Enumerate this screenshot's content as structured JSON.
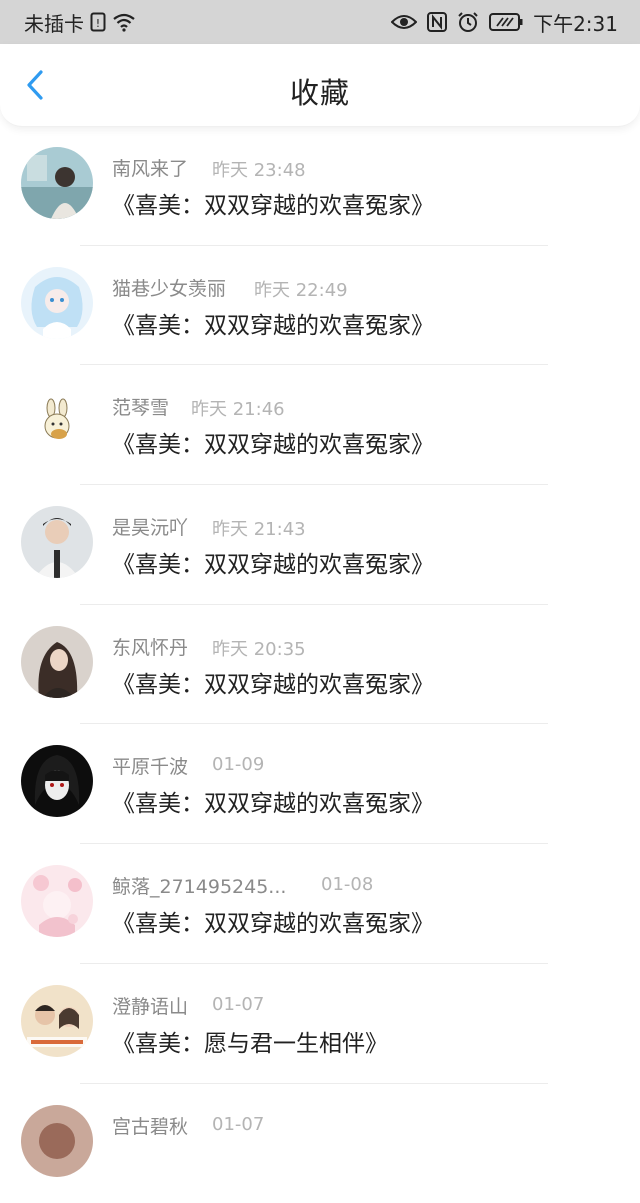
{
  "status_bar": {
    "carrier": "未插卡",
    "time": "下午2:31",
    "icons": [
      "sim-icon",
      "wifi-icon",
      "eye-icon",
      "nfc-icon",
      "alarm-icon",
      "battery-icon"
    ]
  },
  "header": {
    "title": "收藏",
    "back_icon": "chevron-left-icon",
    "accent": "#2f9bf0"
  },
  "items": [
    {
      "name": "南风来了",
      "time": "昨天 23:48",
      "title": "《喜美：双双穿越的欢喜冤家》"
    },
    {
      "name": "猫巷少女羡丽",
      "time": "昨天 22:49",
      "title": "《喜美：双双穿越的欢喜冤家》"
    },
    {
      "name": "范琴雪",
      "time": "昨天 21:46",
      "title": "《喜美：双双穿越的欢喜冤家》"
    },
    {
      "name": "是昊沅吖",
      "time": "昨天 21:43",
      "title": "《喜美：双双穿越的欢喜冤家》"
    },
    {
      "name": "东风怀丹",
      "time": "昨天 20:35",
      "title": "《喜美：双双穿越的欢喜冤家》"
    },
    {
      "name": "平原千波",
      "time": "01-09",
      "title": "《喜美：双双穿越的欢喜冤家》"
    },
    {
      "name": "鲸落_271495245...",
      "time": "01-08",
      "title": "《喜美：双双穿越的欢喜冤家》"
    },
    {
      "name": "澄静语山",
      "time": "01-07",
      "title": "《喜美：愿与君一生相伴》"
    },
    {
      "name": "宫古碧秋",
      "time": "01-07",
      "title": ""
    }
  ]
}
